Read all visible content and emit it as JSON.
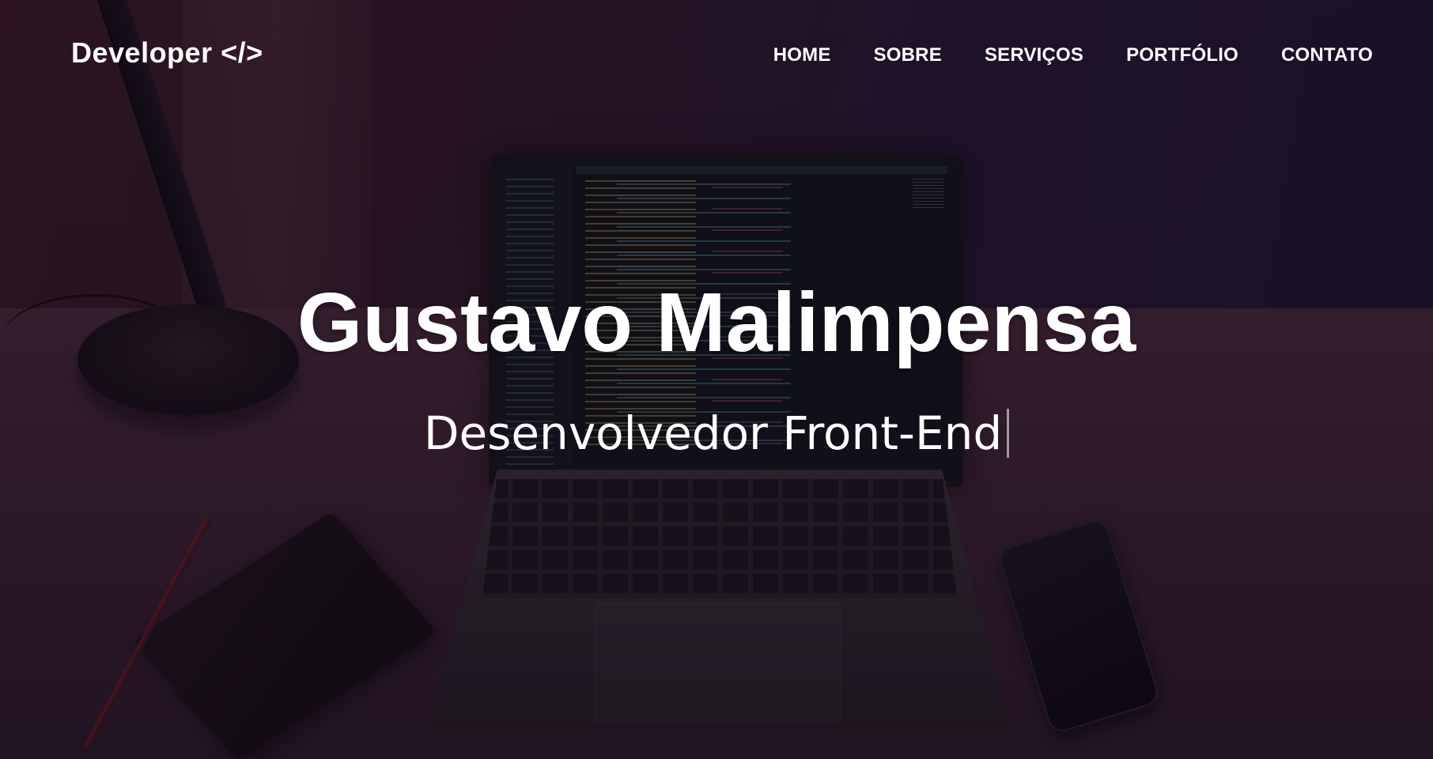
{
  "navbar": {
    "brand": "Developer </>",
    "links": [
      {
        "label": "HOME"
      },
      {
        "label": "SOBRE"
      },
      {
        "label": "SERVIÇOS"
      },
      {
        "label": "PORTFÓLIO"
      },
      {
        "label": "CONTATO"
      }
    ]
  },
  "hero": {
    "name": "Gustavo Malimpensa",
    "role": "Desenvolvedor Front-End"
  },
  "colors": {
    "text": "#ffffff",
    "background_overlay": "#231633"
  }
}
